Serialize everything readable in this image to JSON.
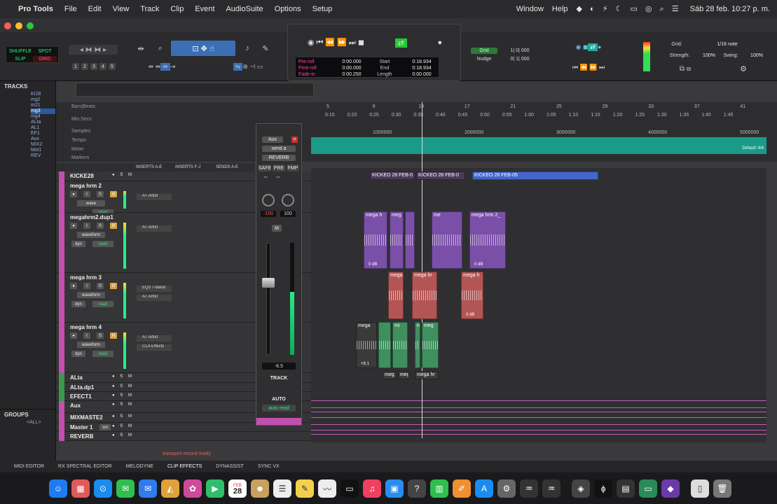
{
  "menubar": {
    "app": "Pro Tools",
    "items": [
      "File",
      "Edit",
      "View",
      "Track",
      "Clip",
      "Event",
      "AudioSuite",
      "Options",
      "Setup"
    ],
    "right_items": [
      "Window",
      "Help"
    ],
    "clock": "Sáb 28 feb.  10:27 p. m."
  },
  "toolbar": {
    "modes": [
      "SHUFFLE",
      "SPOT",
      "SLIP",
      "GRID"
    ],
    "zoom_presets": [
      "1",
      "2",
      "3",
      "4",
      "5"
    ],
    "grid_label": "Grid:",
    "grid_value": "1/16 note",
    "strength_label": "Strength:",
    "strength_value": "100%",
    "swing_label": "Swing:",
    "swing_value": "100%",
    "grid_field": "1| 0| 000",
    "nudge_label": "Nudge",
    "nudge_field": "0| 1| 000",
    "grid_btn": "Grid"
  },
  "transport": {
    "preroll_label": "Pre-roll",
    "preroll": "0:00.000",
    "postroll_label": "Post-roll",
    "postroll": "0:00.000",
    "fadein_label": "Fade-in",
    "fadein": "0:00.250",
    "start_label": "Start",
    "start": "0:18.934",
    "end_label": "End",
    "end": "0:18.934",
    "length_label": "Length",
    "length": "0:00.000"
  },
  "tracks_panel": {
    "title": "TRACKS",
    "items": [
      "KI28",
      "mg2",
      "m21",
      "mg3",
      "mg4",
      "ALta",
      "AL1",
      "EF1",
      "Aux",
      "MIX2",
      "Mst1",
      "REV"
    ]
  },
  "groups_panel": {
    "title": "GROUPS",
    "all": "<ALL>"
  },
  "rulers": {
    "labels": [
      "Bars|Beats",
      "Min:Secs",
      "Samples",
      "Tempo",
      "Meter",
      "Markers"
    ],
    "bars": [
      "5",
      "9",
      "13",
      "17",
      "21",
      "25",
      "29",
      "33",
      "37",
      "41"
    ],
    "minsecs": [
      "0:15",
      "0:20",
      "0:25",
      "0:30",
      "0:35",
      "0:40",
      "0:45",
      "0:50",
      "0:55",
      "1:00",
      "1:05",
      "1:10",
      "1:15",
      "1:20",
      "1:25",
      "1:30",
      "1:35",
      "1:40",
      "1:45"
    ],
    "samples": [
      "1000000",
      "2000000",
      "3000000",
      "4000000",
      "5000000"
    ],
    "meter_default": "Default: 4/4"
  },
  "mix_header": {
    "inserts_ae": "INSERTS A-E",
    "inserts_fj": "INSERTS F-J",
    "sends_ae": "SENDS A-E"
  },
  "tracks": [
    {
      "name": "KICKE28",
      "insert": ""
    },
    {
      "name": "mega hrm 2",
      "insert": "AT Artist",
      "view": "wave",
      "auto": "read"
    },
    {
      "name": "megahrm2.dup1",
      "insert": "AT Artist",
      "view": "waveform",
      "auto": "read",
      "dyn": "dyn"
    },
    {
      "name": "mega hrm 3",
      "insert": "EQ3 7-Band",
      "insert2": "AT Artist",
      "view": "waveform",
      "auto": "read",
      "dyn": "dyn"
    },
    {
      "name": "mega hrm 4",
      "insert": "AT Artist",
      "insert2": "CLA Effects",
      "view": "waveform",
      "auto": "read",
      "dyn": "dyn"
    },
    {
      "name": "ALta"
    },
    {
      "name": "ALta.dp1"
    },
    {
      "name": "EFECT1"
    },
    {
      "name": "Aux"
    },
    {
      "name": "MIXMASTE2"
    },
    {
      "name": "Master 1",
      "vol": "vol"
    },
    {
      "name": "REVERB"
    }
  ],
  "channel_strip": {
    "type": "Aux",
    "send": "send a",
    "bus": "REVERB",
    "safe": "SAFE",
    "pre": "PRE",
    "fmp": "FMP",
    "pan_left": "-100",
    "pan_right": "100",
    "fader_value": "-6.5",
    "track_label": "TRACK",
    "auto_label": "AUTO",
    "auto_mode": "auto read",
    "m_label": "M"
  },
  "clips": {
    "kick": [
      "KICKEO 28 FEB-0",
      "KICKEO 28 FEB-0",
      "KICKEO 28 FEB-05"
    ],
    "hrm2": [
      "mega h",
      "meg",
      "me",
      "mega hrm 2_"
    ],
    "hrm3": [
      "mega",
      "mega hr",
      "mega h"
    ],
    "hrm4": [
      "mega",
      "mi",
      "n",
      "meg"
    ],
    "hrm4_bottom": [
      "meg",
      "meg",
      "mega hr"
    ],
    "db0": "0 dB",
    "db8": "+8.1"
  },
  "status": "transport record ready",
  "bottom_tabs": [
    "MIDI EDITOR",
    "RX SPECTRAL EDITOR",
    "MELODYNE",
    "CLIP EFFECTS",
    "DYNASSIST",
    "SYNC VX"
  ],
  "dock_calendar": {
    "month": "FEB",
    "day": "28"
  },
  "colors": {
    "accent_teal": "#1a9b8a",
    "track_magenta": "#c24fb0",
    "clip_purple": "#7a4fa8",
    "clip_red": "#b45555",
    "clip_green": "#3f8f5f",
    "clip_blue": "#4466cc"
  }
}
